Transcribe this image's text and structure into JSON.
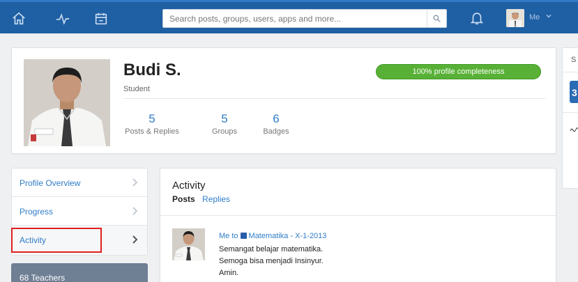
{
  "topbar": {
    "nav_icons": [
      "home-icon",
      "activity-pulse-icon",
      "calendar-icon"
    ],
    "search_placeholder": "Search posts, groups, users, apps and more...",
    "user_label": "Me",
    "colors": {
      "bar": "#1f5fa3",
      "bar_accent": "#2f79c6"
    }
  },
  "profile": {
    "name": "Budi S.",
    "role": "Student",
    "completeness_label": "100% profile completeness",
    "completeness": 1.0,
    "stats": [
      {
        "value": "5",
        "label": "Posts & Replies"
      },
      {
        "value": "5",
        "label": "Groups"
      },
      {
        "value": "6",
        "label": "Badges"
      }
    ]
  },
  "menu": {
    "items": [
      {
        "label": "Profile Overview"
      },
      {
        "label": "Progress"
      },
      {
        "label": "Activity",
        "active": true
      }
    ],
    "teachers_label": "68 Teachers"
  },
  "activity": {
    "title": "Activity",
    "tabs": [
      "Posts",
      "Replies"
    ],
    "post": {
      "from": "Me",
      "to_word": "to",
      "group": "Matematika - X-1-2013",
      "lines": [
        "Semangat belajar matematika.",
        "Semoga bisa menjadi Insinyur.",
        "Amin."
      ]
    }
  },
  "right_panel": {
    "heading_fragment": "S",
    "logo_fragment": "3"
  },
  "colors": {
    "link": "#2f7dc8",
    "progress": "#58b136",
    "highlight": "#e02020",
    "teachers_bg": "#6f7f94"
  }
}
